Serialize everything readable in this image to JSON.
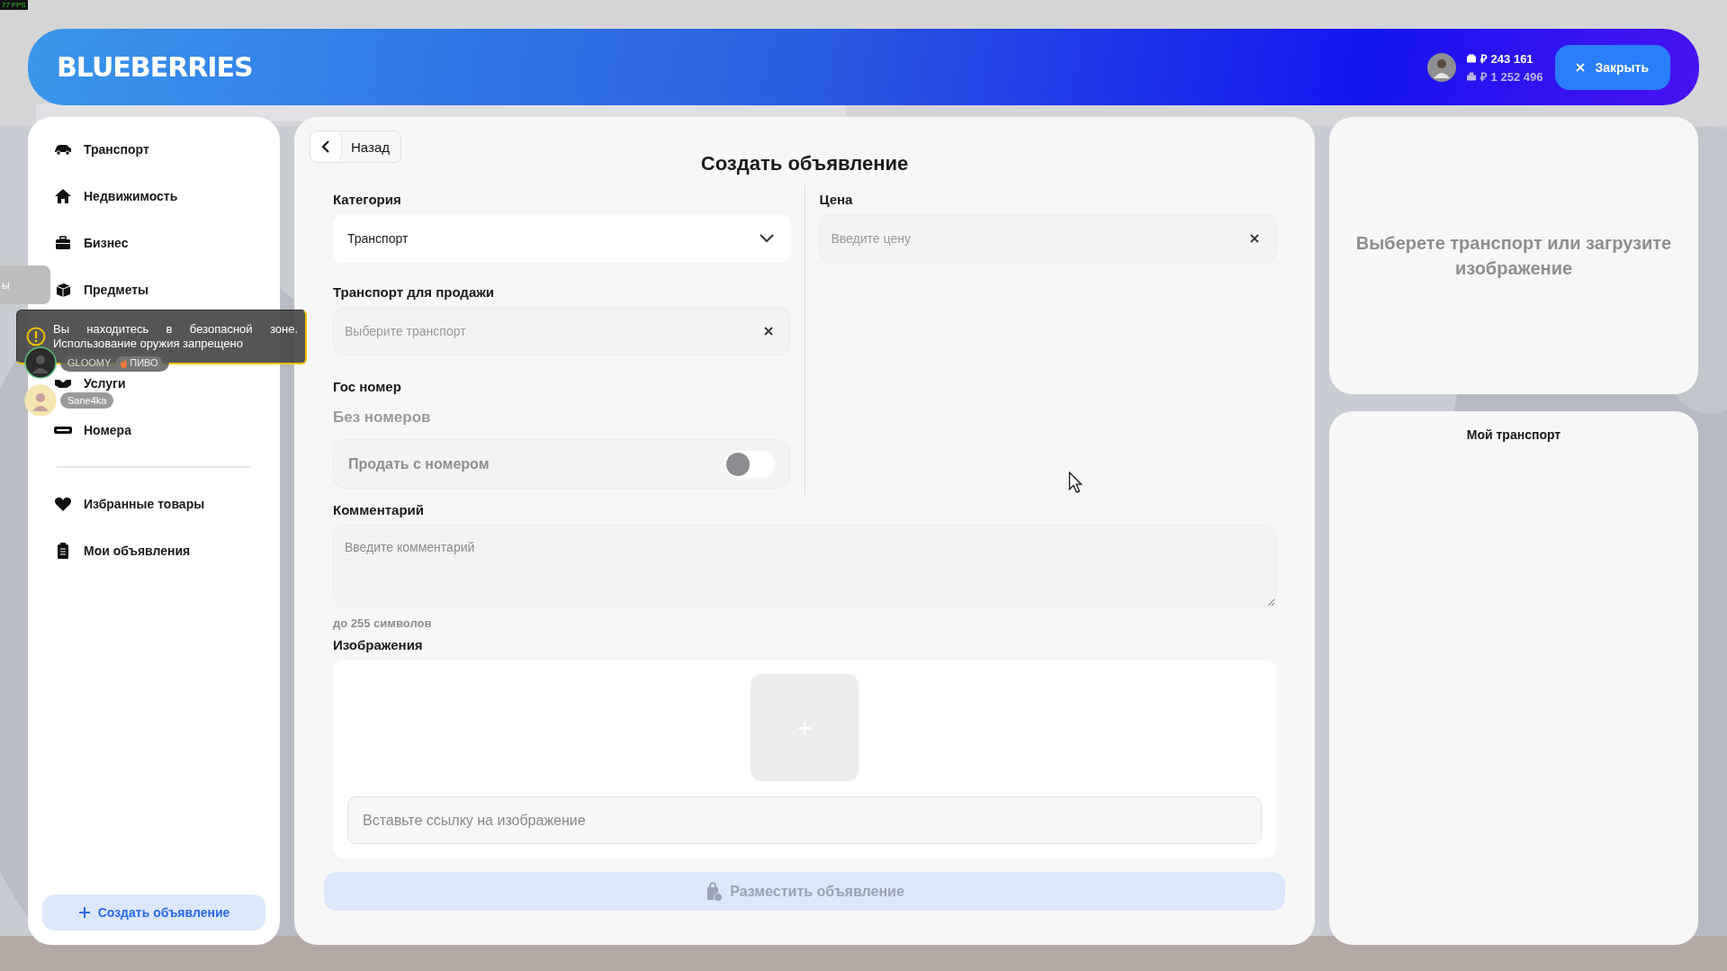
{
  "fps": "77 FPS",
  "header": {
    "logo": "BLUEBERRIES",
    "balance_cash": "₽ 243 161",
    "balance_bank": "₽ 1 252 496",
    "close_button": "Закрыть"
  },
  "side_tab": "ы",
  "sidebar": {
    "items": [
      {
        "label": "Транспорт",
        "kind": "car"
      },
      {
        "label": "Недвижимость",
        "kind": "house"
      },
      {
        "label": "Бизнес",
        "kind": "briefcase"
      },
      {
        "label": "Предметы",
        "kind": "box"
      },
      {
        "label": "Услуги",
        "kind": "handshake"
      },
      {
        "label": "Номера",
        "kind": "plate"
      }
    ],
    "extra_items": [
      {
        "label": "Избранные товары",
        "kind": "heart"
      },
      {
        "label": "Мои объявления",
        "kind": "clipboard"
      }
    ],
    "create_button": "Создать объявление"
  },
  "notification": {
    "text": "Вы находитесь в безопасной зоне. Использование оружия запрещено"
  },
  "players": [
    {
      "name": "GLOOMY",
      "tag": "ПИВО"
    },
    {
      "name": "Sane4ka"
    }
  ],
  "form": {
    "back_button": "Назад",
    "title": "Создать объявление",
    "category": {
      "label": "Категория",
      "value": "Транспорт"
    },
    "vehicle": {
      "label": "Транспорт для продажи",
      "placeholder": "Выберите транспорт"
    },
    "plate": {
      "label": "Гос номер",
      "value": "Без номеров"
    },
    "sell_with_plate": {
      "label": "Продать с номером",
      "on": false
    },
    "price": {
      "label": "Цена",
      "placeholder": "Введите цену"
    },
    "comment": {
      "label": "Комментарий",
      "placeholder": "Введите комментарий",
      "hint": "до 255 символов"
    },
    "images": {
      "label": "Изображения",
      "placeholder": "Вставьте ссылку на изображение"
    },
    "submit_button": "Разместить объявление"
  },
  "preview": {
    "text": "Выберете транспорт или загрузите изображение"
  },
  "my_vehicles": {
    "title": "Мой транспорт"
  }
}
